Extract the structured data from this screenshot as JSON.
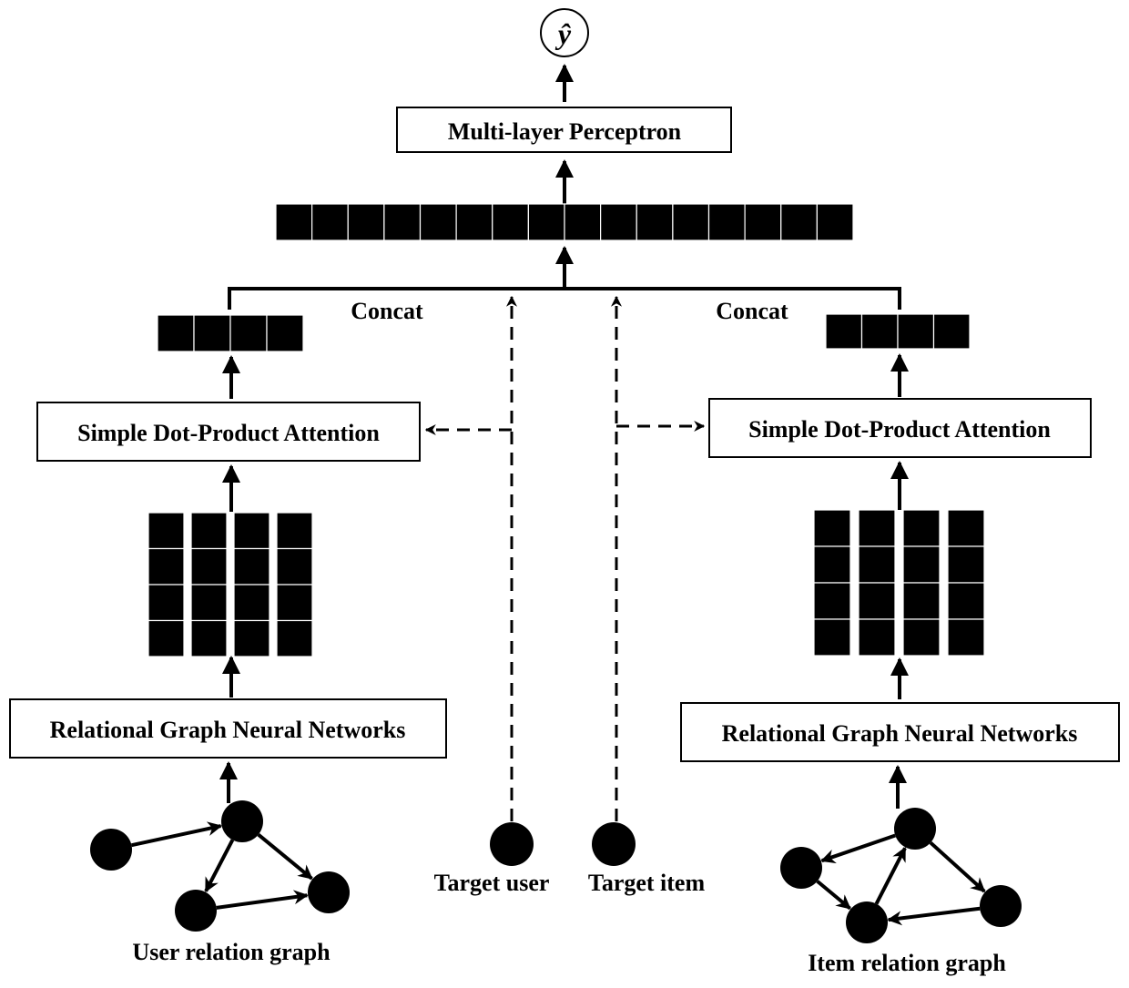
{
  "diagram": {
    "output": {
      "symbol": "ŷ",
      "name": "predicted-rating"
    },
    "mlp": {
      "label": "Multi-layer Perceptron"
    },
    "concat_vector": {
      "cells": 16
    },
    "concat_left": {
      "label": "Concat"
    },
    "concat_right": {
      "label": "Concat"
    },
    "user_branch": {
      "attention": {
        "label": "Simple Dot-Product Attention"
      },
      "pooled_vector": {
        "cells": 4
      },
      "matrix": {
        "rows": 4,
        "cols": 4
      },
      "rgnn": {
        "label": "Relational Graph Neural Networks"
      },
      "graph": {
        "label": "User relation graph",
        "nodes": [
          "u1",
          "u2",
          "u3",
          "u4"
        ],
        "edges": [
          [
            "u1",
            "u2"
          ],
          [
            "u2",
            "u3"
          ],
          [
            "u2",
            "u4"
          ],
          [
            "u3",
            "u4"
          ]
        ]
      }
    },
    "item_branch": {
      "attention": {
        "label": "Simple Dot-Product Attention"
      },
      "pooled_vector": {
        "cells": 4
      },
      "matrix": {
        "rows": 4,
        "cols": 4
      },
      "rgnn": {
        "label": "Relational Graph Neural Networks"
      },
      "graph": {
        "label": "Item relation graph",
        "nodes": [
          "i1",
          "i2",
          "i3",
          "i4"
        ],
        "edges": [
          [
            "i2",
            "i1"
          ],
          [
            "i1",
            "i3"
          ],
          [
            "i3",
            "i2"
          ],
          [
            "i2",
            "i4"
          ],
          [
            "i4",
            "i3"
          ]
        ]
      }
    },
    "target_user": {
      "label": "Target user"
    },
    "target_item": {
      "label": "Target item"
    }
  }
}
